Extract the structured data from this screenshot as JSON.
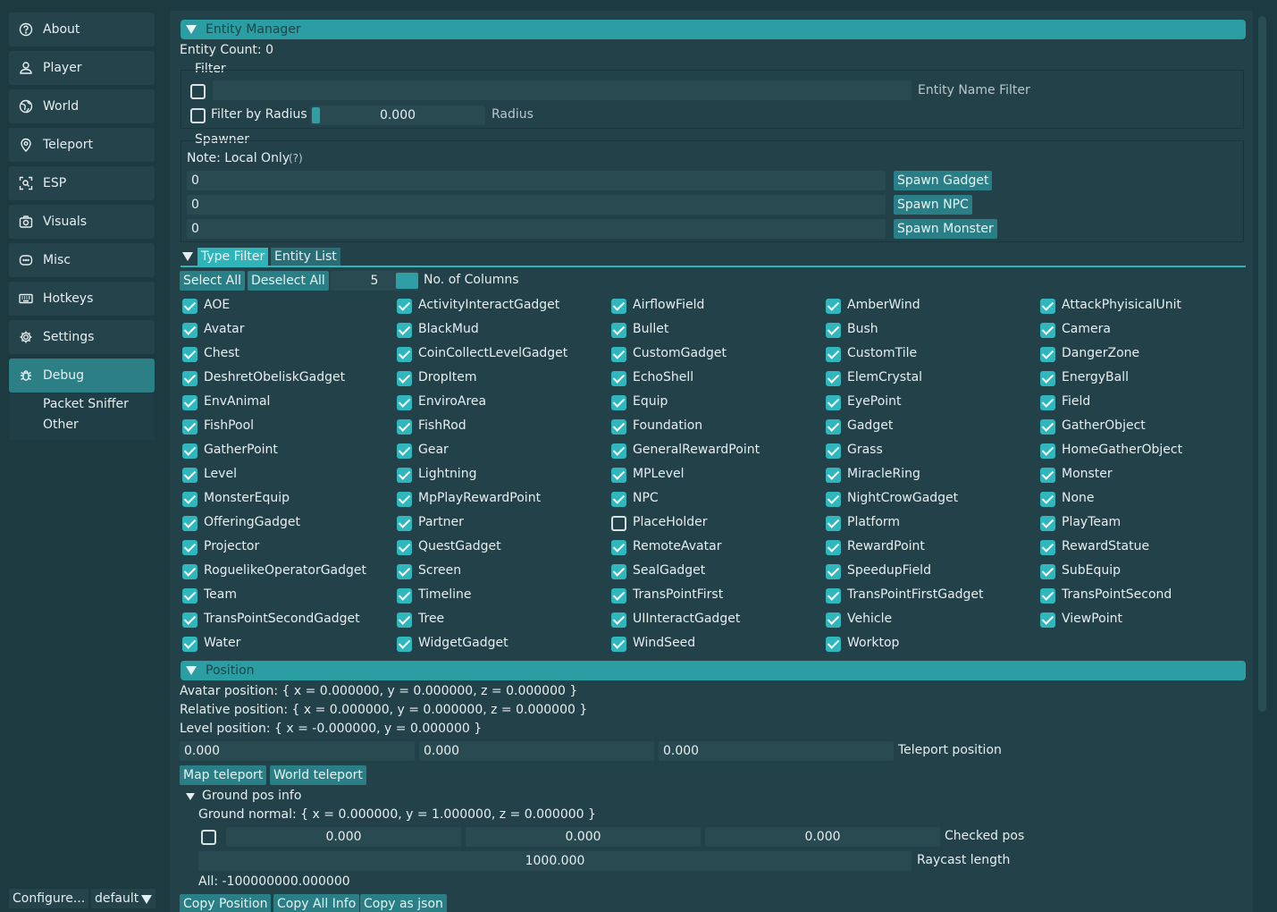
{
  "sidebar": {
    "items": [
      {
        "label": "About",
        "icon": "question-circle-icon"
      },
      {
        "label": "Player",
        "icon": "person-icon"
      },
      {
        "label": "World",
        "icon": "globe-icon"
      },
      {
        "label": "Teleport",
        "icon": "location-pin-icon"
      },
      {
        "label": "ESP",
        "icon": "scan-icon"
      },
      {
        "label": "Visuals",
        "icon": "camera-icon"
      },
      {
        "label": "Misc",
        "icon": "message-icon"
      },
      {
        "label": "Hotkeys",
        "icon": "keyboard-icon"
      },
      {
        "label": "Settings",
        "icon": "gear-icon"
      },
      {
        "label": "Debug",
        "icon": "bug-icon"
      }
    ],
    "active": "Debug",
    "subitems": [
      "Packet Sniffer",
      "Other"
    ],
    "configure_label": "Configure...",
    "profile_label": "default"
  },
  "entity_manager": {
    "title": "Entity Manager",
    "entity_count": "Entity Count: 0",
    "filter": {
      "title": "Filter",
      "name_filter_label": "Entity Name Filter",
      "name_filter_value": "",
      "radius_checkbox_label": "Filter by Radius",
      "radius_value": "0.000",
      "radius_label": "Radius"
    },
    "spawner": {
      "title": "Spawner",
      "note": "Note: Local Only",
      "help": "(?)",
      "gadget_value": "0",
      "npc_value": "0",
      "monster_value": "0",
      "spawn_gadget": "Spawn Gadget",
      "spawn_npc": "Spawn NPC",
      "spawn_monster": "Spawn Monster"
    },
    "tabs": [
      "Type Filter",
      "Entity List"
    ],
    "active_tab": "Type Filter",
    "select_all": "Select All",
    "deselect_all": "Deselect All",
    "columns_value": "5",
    "columns_label": "No. of Columns",
    "types": [
      {
        "name": "AOE",
        "checked": true
      },
      {
        "name": "ActivityInteractGadget",
        "checked": true
      },
      {
        "name": "AirflowField",
        "checked": true
      },
      {
        "name": "AmberWind",
        "checked": true
      },
      {
        "name": "AttackPhyisicalUnit",
        "checked": true
      },
      {
        "name": "Avatar",
        "checked": true
      },
      {
        "name": "BlackMud",
        "checked": true
      },
      {
        "name": "Bullet",
        "checked": true
      },
      {
        "name": "Bush",
        "checked": true
      },
      {
        "name": "Camera",
        "checked": true
      },
      {
        "name": "Chest",
        "checked": true
      },
      {
        "name": "CoinCollectLevelGadget",
        "checked": true
      },
      {
        "name": "CustomGadget",
        "checked": true
      },
      {
        "name": "CustomTile",
        "checked": true
      },
      {
        "name": "DangerZone",
        "checked": true
      },
      {
        "name": "DeshretObeliskGadget",
        "checked": true
      },
      {
        "name": "DropItem",
        "checked": true
      },
      {
        "name": "EchoShell",
        "checked": true
      },
      {
        "name": "ElemCrystal",
        "checked": true
      },
      {
        "name": "EnergyBall",
        "checked": true
      },
      {
        "name": "EnvAnimal",
        "checked": true
      },
      {
        "name": "EnviroArea",
        "checked": true
      },
      {
        "name": "Equip",
        "checked": true
      },
      {
        "name": "EyePoint",
        "checked": true
      },
      {
        "name": "Field",
        "checked": true
      },
      {
        "name": "FishPool",
        "checked": true
      },
      {
        "name": "FishRod",
        "checked": true
      },
      {
        "name": "Foundation",
        "checked": true
      },
      {
        "name": "Gadget",
        "checked": true
      },
      {
        "name": "GatherObject",
        "checked": true
      },
      {
        "name": "GatherPoint",
        "checked": true
      },
      {
        "name": "Gear",
        "checked": true
      },
      {
        "name": "GeneralRewardPoint",
        "checked": true
      },
      {
        "name": "Grass",
        "checked": true
      },
      {
        "name": "HomeGatherObject",
        "checked": true
      },
      {
        "name": "Level",
        "checked": true
      },
      {
        "name": "Lightning",
        "checked": true
      },
      {
        "name": "MPLevel",
        "checked": true
      },
      {
        "name": "MiracleRing",
        "checked": true
      },
      {
        "name": "Monster",
        "checked": true
      },
      {
        "name": "MonsterEquip",
        "checked": true
      },
      {
        "name": "MpPlayRewardPoint",
        "checked": true
      },
      {
        "name": "NPC",
        "checked": true
      },
      {
        "name": "NightCrowGadget",
        "checked": true
      },
      {
        "name": "None",
        "checked": true
      },
      {
        "name": "OfferingGadget",
        "checked": true
      },
      {
        "name": "Partner",
        "checked": true
      },
      {
        "name": "PlaceHolder",
        "checked": false
      },
      {
        "name": "Platform",
        "checked": true
      },
      {
        "name": "PlayTeam",
        "checked": true
      },
      {
        "name": "Projector",
        "checked": true
      },
      {
        "name": "QuestGadget",
        "checked": true
      },
      {
        "name": "RemoteAvatar",
        "checked": true
      },
      {
        "name": "RewardPoint",
        "checked": true
      },
      {
        "name": "RewardStatue",
        "checked": true
      },
      {
        "name": "RoguelikeOperatorGadget",
        "checked": true
      },
      {
        "name": "Screen",
        "checked": true
      },
      {
        "name": "SealGadget",
        "checked": true
      },
      {
        "name": "SpeedupField",
        "checked": true
      },
      {
        "name": "SubEquip",
        "checked": true
      },
      {
        "name": "Team",
        "checked": true
      },
      {
        "name": "Timeline",
        "checked": true
      },
      {
        "name": "TransPointFirst",
        "checked": true
      },
      {
        "name": "TransPointFirstGadget",
        "checked": true
      },
      {
        "name": "TransPointSecond",
        "checked": true
      },
      {
        "name": "TransPointSecondGadget",
        "checked": true
      },
      {
        "name": "Tree",
        "checked": true
      },
      {
        "name": "UIInteractGadget",
        "checked": true
      },
      {
        "name": "Vehicle",
        "checked": true
      },
      {
        "name": "ViewPoint",
        "checked": true
      },
      {
        "name": "Water",
        "checked": true
      },
      {
        "name": "WidgetGadget",
        "checked": true
      },
      {
        "name": "WindSeed",
        "checked": true
      },
      {
        "name": "Worktop",
        "checked": true
      }
    ]
  },
  "position": {
    "title": "Position",
    "avatar_position": "Avatar position: { x = 0.000000, y = 0.000000, z = 0.000000 }",
    "relative_position": "Relative position: { x = 0.000000, y = 0.000000, z = 0.000000 }",
    "level_position": "Level position: { x = -0.000000, y = 0.000000 }",
    "teleport_x": "0.000",
    "teleport_y": "0.000",
    "teleport_z": "0.000",
    "teleport_label": "Teleport position",
    "map_teleport": "Map teleport",
    "world_teleport": "World teleport",
    "ground_info_title": "Ground pos info",
    "ground_normal": "Ground normal: { x = 0.000000, y = 1.000000, z = 0.000000 }",
    "checked_x": "0.000",
    "checked_y": "0.000",
    "checked_z": "0.000",
    "checked_label": "Checked pos",
    "raycast_value": "1000.000",
    "raycast_label": "Raycast length",
    "all_value": "All: -100000000.000000",
    "copy_position": "Copy Position",
    "copy_all_info": "Copy All Info",
    "copy_as_json": "Copy as json"
  },
  "colors": {
    "background": "#1c3a41",
    "panel": "#234148",
    "accent": "#2a9ea3",
    "button": "#2a7f86",
    "checkbox": "#2fb7bd"
  }
}
